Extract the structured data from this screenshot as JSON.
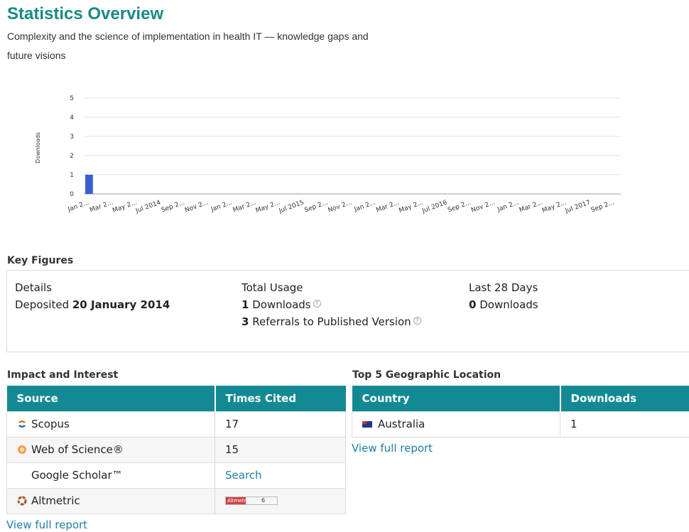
{
  "header": {
    "title": "Statistics Overview",
    "subtitle": "Complexity and the science of implementation in health IT — knowledge gaps and future visions"
  },
  "chart_data": {
    "type": "bar",
    "ylabel": "Downloads",
    "xlabel": "",
    "ylim": [
      0,
      5
    ],
    "yticks": [
      "5",
      "4",
      "3",
      "2",
      "1",
      "0"
    ],
    "categories": [
      "Jan 2...",
      "Mar 2...",
      "May 2...",
      "Jul 2014",
      "Sep 2...",
      "Nov 2...",
      "Jan 2...",
      "Mar 2...",
      "May 2...",
      "Jul 2015",
      "Sep 2...",
      "Nov 2...",
      "Jan 2...",
      "Mar 2...",
      "May 2...",
      "Jul 2016",
      "Sep 2...",
      "Nov 2...",
      "Jan 2...",
      "Mar 2...",
      "May 2...",
      "Jul 2017",
      "Sep 2..."
    ],
    "series": [
      {
        "values": [
          1,
          0,
          0,
          0,
          0,
          0,
          0,
          0,
          0,
          0,
          0,
          0,
          0,
          0,
          0,
          0,
          0,
          0,
          0,
          0,
          0,
          0,
          0
        ]
      }
    ],
    "bar_color": "#3a5fd0",
    "grid": true
  },
  "key_figures": {
    "heading": "Key Figures",
    "details_label": "Details",
    "deposited_prefix": "Deposited",
    "deposited_date": "20 January 2014",
    "total_usage_label": "Total Usage",
    "downloads_count": "1",
    "downloads_label": "Downloads",
    "referrals_count": "3",
    "referrals_label": "Referrals to Published Version",
    "last28_label": "Last 28 Days",
    "last28_count": "0",
    "last28_downloads_label": "Downloads"
  },
  "impact": {
    "heading": "Impact and Interest",
    "col_source": "Source",
    "col_cited": "Times Cited",
    "rows": [
      {
        "source": "Scopus",
        "cited": "17",
        "icon": "scopus-icon"
      },
      {
        "source": "Web of Science®",
        "cited": "15",
        "icon": "web-of-science-icon"
      },
      {
        "source": "Google Scholar™",
        "cited": "Search",
        "icon": ""
      },
      {
        "source": "Altmetric",
        "cited": "6",
        "icon": "altmetric-icon"
      }
    ],
    "altmetric_badge_text": "Altmetric",
    "view_full_report": "View full report"
  },
  "geo": {
    "heading": "Top 5 Geographic Location",
    "col_country": "Country",
    "col_downloads": "Downloads",
    "rows": [
      {
        "country": "Australia",
        "downloads": "1"
      }
    ],
    "view_full_report": "View full report"
  }
}
